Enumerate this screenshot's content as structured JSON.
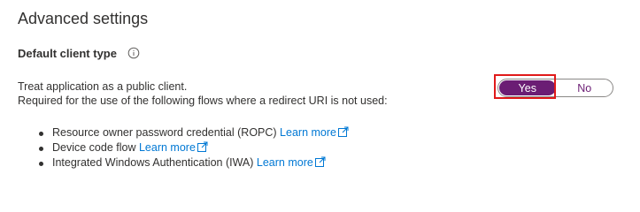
{
  "section": {
    "title": "Advanced settings"
  },
  "client_type": {
    "label": "Default client type",
    "info_icon": "info-circle-icon",
    "description_line1": "Treat application as a public client.",
    "description_line2": "Required for the use of the following flows where a redirect URI is not used:"
  },
  "toggle": {
    "yes_label": "Yes",
    "no_label": "No",
    "selected": "Yes",
    "accent_color": "#6b1d74",
    "highlight_color": "#e01a1a"
  },
  "flows": [
    {
      "text": "Resource owner password credential (ROPC) ",
      "link": "Learn more",
      "icon": "external-link-icon"
    },
    {
      "text": "Device code flow ",
      "link": "Learn more",
      "icon": "external-link-icon"
    },
    {
      "text": "Integrated Windows Authentication (IWA) ",
      "link": "Learn more",
      "icon": "external-link-icon"
    }
  ],
  "colors": {
    "link": "#0078d4",
    "text": "#323130"
  }
}
